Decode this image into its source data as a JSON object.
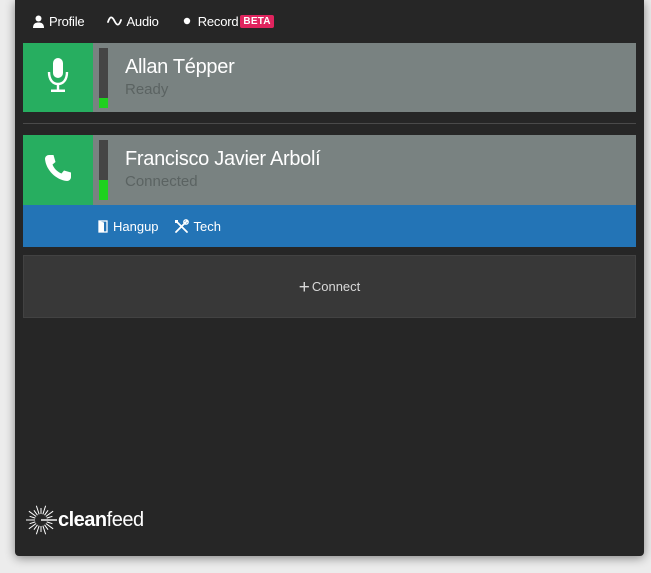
{
  "nav": {
    "profile_label": "Profile",
    "audio_label": "Audio",
    "record_label": "Record",
    "record_badge": "BETA"
  },
  "participants": [
    {
      "name": "Allan Tépper",
      "status": "Ready",
      "icon": "microphone-icon",
      "level": 0.17
    },
    {
      "name": "Francisco Javier Arbolí",
      "status": "Connected",
      "icon": "phone-icon",
      "level": 0.33
    }
  ],
  "actions": {
    "hangup_label": "Hangup",
    "tech_label": "Tech"
  },
  "connect": {
    "plus": "+",
    "label": "Connect"
  },
  "logo": {
    "part1": "clean",
    "part2": "feed"
  },
  "colors": {
    "accent_green": "#27ae60",
    "meter_green": "#1fd11f",
    "action_blue": "#2374b6",
    "beta_pink": "#e0245e",
    "row_gray": "#798281"
  }
}
